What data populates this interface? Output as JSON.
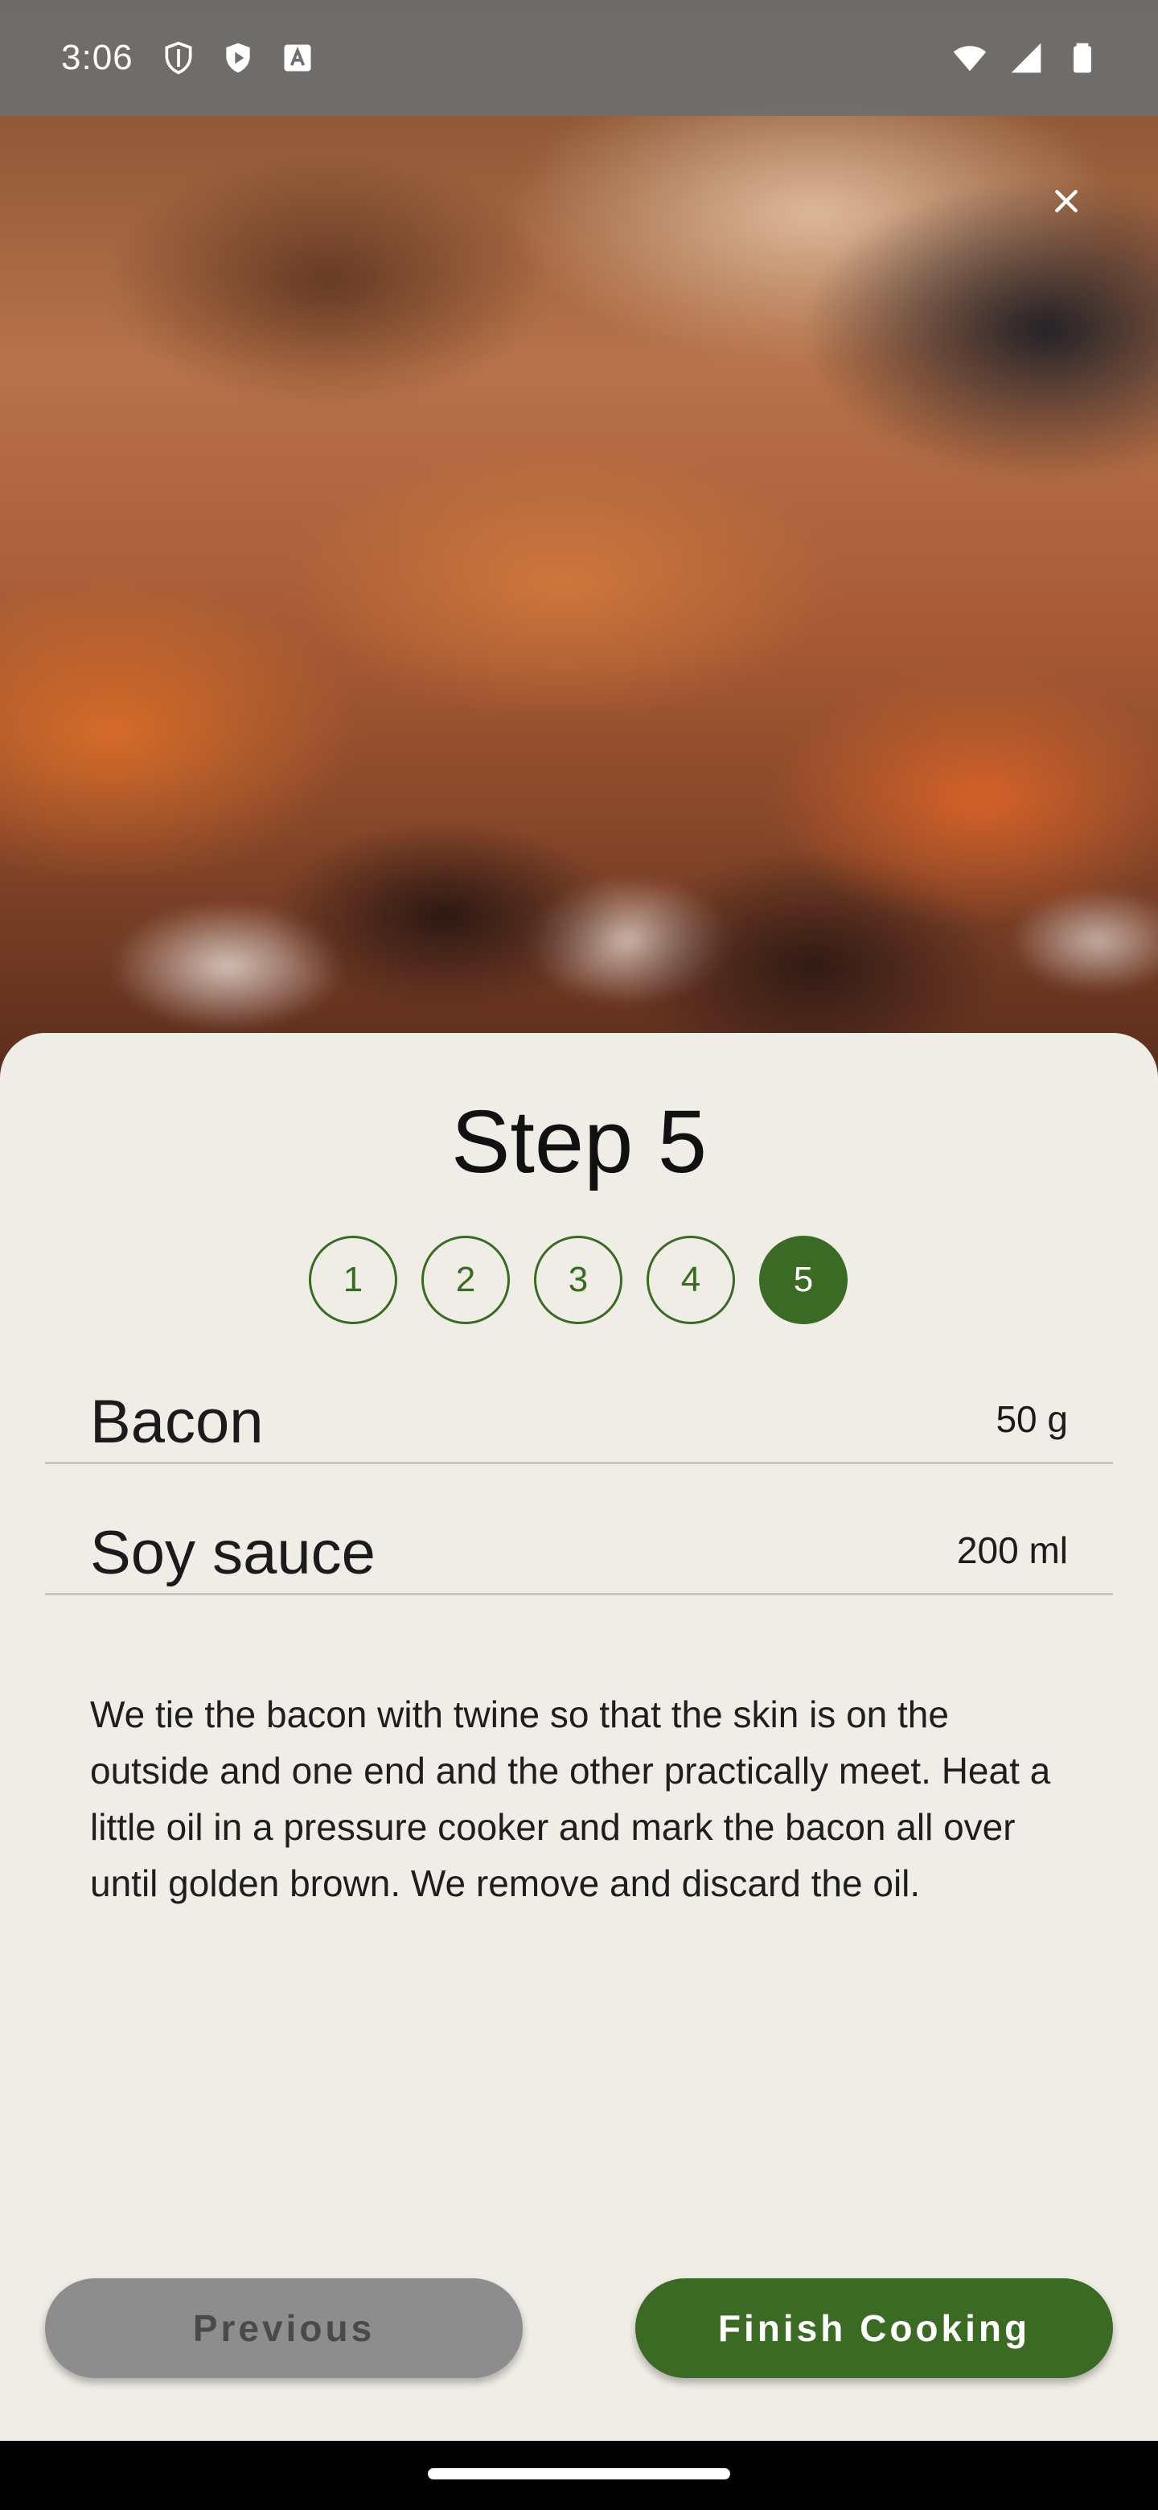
{
  "status_bar": {
    "time": "3:06",
    "left_icons": [
      "shield-icon",
      "play-protect-icon",
      "font-a-icon"
    ],
    "right_icons": [
      "wifi-icon",
      "signal-icon",
      "battery-icon"
    ]
  },
  "hero": {
    "image": "blurred-bacon-photo",
    "close_icon": "close-icon"
  },
  "step": {
    "title": "Step 5",
    "indicators": [
      "1",
      "2",
      "3",
      "4",
      "5"
    ],
    "active_index": 4
  },
  "ingredients": [
    {
      "name": "Bacon",
      "quantity": "50 g"
    },
    {
      "name": "Soy sauce",
      "quantity": "200 ml"
    }
  ],
  "description": "We tie the bacon with twine so that the skin is on the outside and one end and the other practically meet. Heat a little oil in a pressure cooker and mark the bacon all over until golden brown. We remove and discard the oil.",
  "buttons": {
    "previous": "Previous",
    "finish": "Finish Cooking"
  },
  "colors": {
    "accent": "#3a6a24",
    "sheet_background": "#f0ede6",
    "disabled_button": "#8d8d8d"
  }
}
